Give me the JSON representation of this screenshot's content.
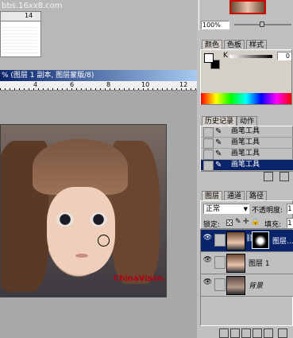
{
  "watermark": "bbs.16xx8.com",
  "ruler_top_numbers": [
    "14"
  ],
  "document": {
    "title_suffix": "% (图层 1 副本, 图层蒙版/8)",
    "ruler_numbers": [
      "4",
      "6",
      "8",
      "10",
      "12"
    ],
    "image_watermark": "ChinaVisen.c"
  },
  "navigator": {
    "zoom": "100%"
  },
  "color_panel": {
    "tabs": [
      "颜色",
      "色板",
      "样式"
    ],
    "channel_label": "K",
    "slider_value": "0",
    "foreground": "#ffffff",
    "background": "#000000"
  },
  "history_panel": {
    "tabs": [
      "历史记录",
      "动作"
    ],
    "items": [
      "画笔工具",
      "画笔工具",
      "画笔工具",
      "画笔工具"
    ],
    "selected_index": 3
  },
  "layers_panel": {
    "tabs": [
      "图层",
      "通道",
      "路径"
    ],
    "blend_mode": "正常",
    "opacity_label": "不透明度:",
    "opacity_value": "1",
    "lock_label": "锁定:",
    "fill_label": "填充:",
    "fill_value": "1",
    "layers": [
      {
        "name": "图层...",
        "selected": true,
        "has_mask": true
      },
      {
        "name": "图层 1",
        "selected": false,
        "has_mask": false
      },
      {
        "name": "背景",
        "selected": false,
        "has_mask": false
      }
    ],
    "footer_icons": [
      "link-icon",
      "add-style-icon",
      "add-mask-icon",
      "new-set-icon",
      "adjustment-icon",
      "new-layer-icon",
      "trash-icon"
    ]
  }
}
